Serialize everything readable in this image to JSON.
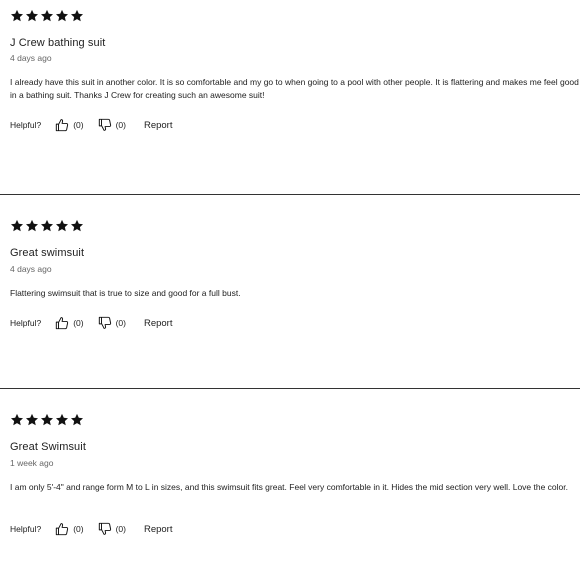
{
  "reviews": [
    {
      "rating": 5,
      "title": "J Crew bathing suit",
      "date": "4 days ago",
      "body": "I already have this suit in another color. It is so comfortable and my go to when going to a pool with other people. It is flattering and makes me feel good in a bathing suit. Thanks J Crew for creating such an awesome suit!",
      "helpful_label": "Helpful?",
      "up_count": "(0)",
      "down_count": "(0)",
      "report_label": "Report"
    },
    {
      "rating": 5,
      "title": "Great swimsuit",
      "date": "4 days ago",
      "body": "Flattering swimsuit that is true to size and good for a full bust.",
      "helpful_label": "Helpful?",
      "up_count": "(0)",
      "down_count": "(0)",
      "report_label": "Report"
    },
    {
      "rating": 5,
      "title": "Great Swimsuit",
      "date": "1 week ago",
      "body": "I am only 5'-4\" and range form M to L in sizes, and this swimsuit fits great. Feel very comfortable in it. Hides the mid section very well. Love the color.",
      "helpful_label": "Helpful?",
      "up_count": "(0)",
      "down_count": "(0)",
      "report_label": "Report"
    }
  ],
  "icons": {
    "star": "star-icon",
    "thumbs_up": "thumbs-up-icon",
    "thumbs_down": "thumbs-down-icon"
  },
  "colors": {
    "star": "#111111",
    "divider": "#333333"
  }
}
